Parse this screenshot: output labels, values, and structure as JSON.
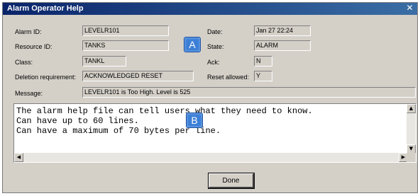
{
  "window": {
    "title": "Alarm Operator Help",
    "close_glyph": "✕"
  },
  "labels": {
    "alarm_id": "Alarm ID:",
    "resource_id": "Resource ID:",
    "class": "Class:",
    "deletion": "Deletion requirement:",
    "message": "Message:",
    "date": "Date:",
    "state": "State:",
    "ack": "Ack:",
    "reset_allowed": "Reset allowed:"
  },
  "values": {
    "alarm_id": "LEVELR101",
    "resource_id": "TANKS",
    "class": "TANKL",
    "deletion": "ACKNOWLEDGED RESET",
    "message": "LEVELR101 is Too High. Level is 525",
    "date": "Jan 27 22:24",
    "state": "ALARM",
    "ack": "N",
    "reset_allowed": "Y"
  },
  "callouts": {
    "a": "A",
    "b": "B"
  },
  "help_text": [
    "The alarm help file can tell users what they need to know.",
    "Can have up to 60 lines.",
    "Can have a maximum of 70 bytes per line."
  ],
  "scroll_glyphs": {
    "up": "▲",
    "down": "▼",
    "left": "◀",
    "right": "▶"
  },
  "buttons": {
    "done": "Done"
  }
}
